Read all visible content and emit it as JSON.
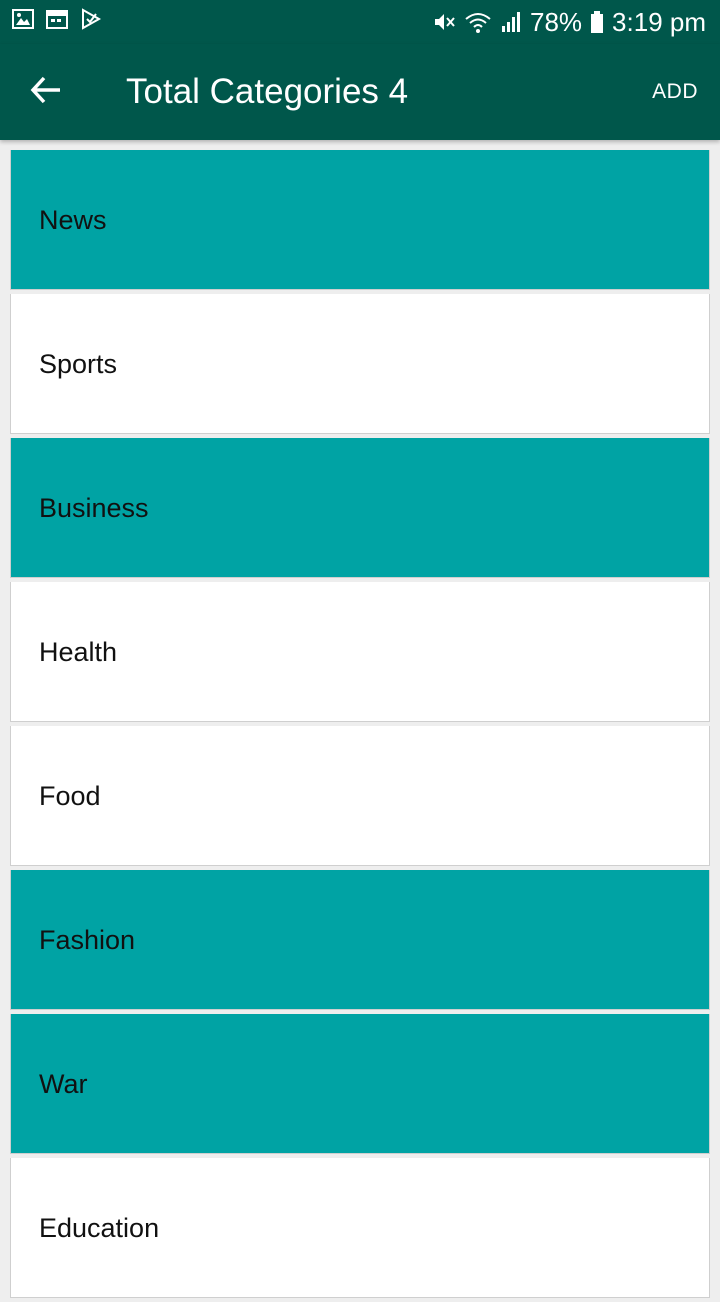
{
  "status_bar": {
    "battery": "78%",
    "time": "3:19 pm",
    "left_icons": [
      "gallery-icon",
      "calendar-icon",
      "play-store-icon"
    ],
    "right_icons": [
      "mute-icon",
      "wifi-icon",
      "signal-icon",
      "battery-icon"
    ]
  },
  "app_bar": {
    "title": "Total Categories 4",
    "action_label": "ADD",
    "background_color": "#00574b"
  },
  "colors": {
    "highlight": "#00a3a4",
    "normal": "#ffffff"
  },
  "categories": [
    {
      "label": "News",
      "highlighted": true
    },
    {
      "label": "Sports",
      "highlighted": false
    },
    {
      "label": "Business",
      "highlighted": true
    },
    {
      "label": "Health",
      "highlighted": false
    },
    {
      "label": "Food",
      "highlighted": false
    },
    {
      "label": "Fashion",
      "highlighted": true
    },
    {
      "label": "War",
      "highlighted": true
    },
    {
      "label": "Education",
      "highlighted": false
    }
  ]
}
